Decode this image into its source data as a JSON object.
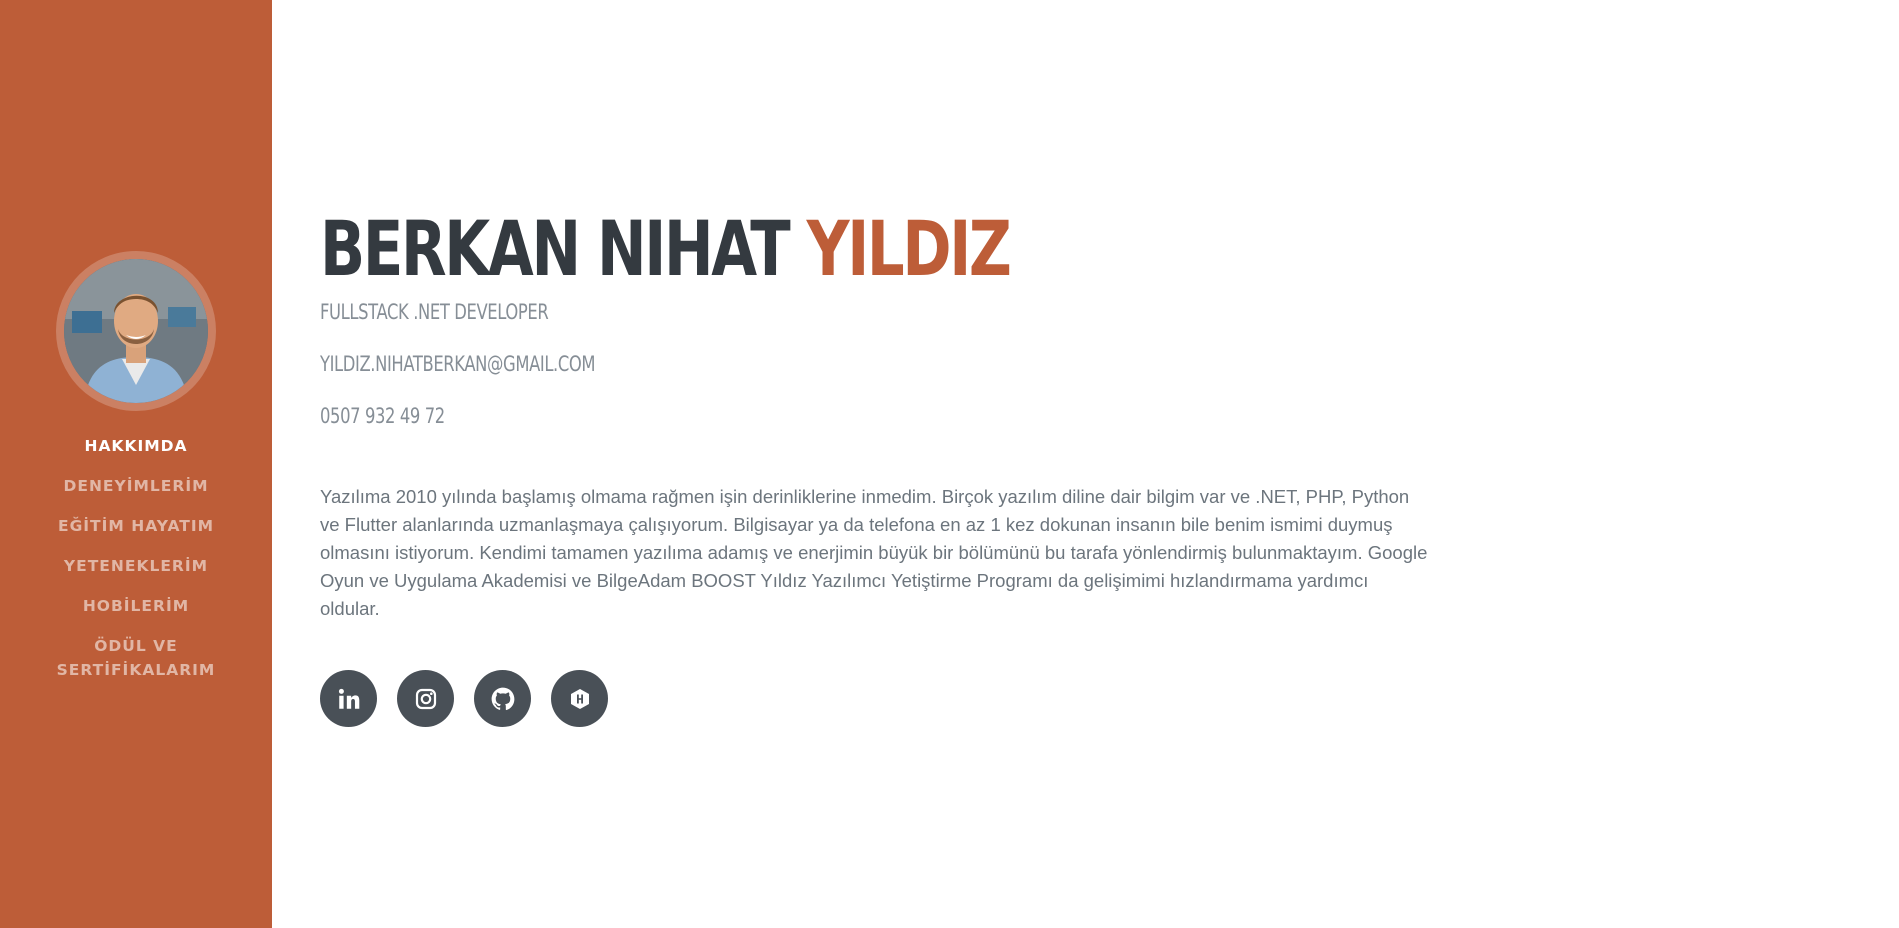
{
  "sidebar": {
    "avatar_alt": "Profile photo",
    "nav": [
      {
        "label": "HAKKIMDA",
        "active": true
      },
      {
        "label": "DENEYİMLERİM",
        "active": false
      },
      {
        "label": "EĞİTİM HAYATIM",
        "active": false
      },
      {
        "label": "YETENEKLERİM",
        "active": false
      },
      {
        "label": "HOBİLERİM",
        "active": false
      },
      {
        "label": "ÖDÜL VE SERTİFİKALARIM",
        "active": false
      }
    ],
    "background_color": "#bd5d38"
  },
  "profile": {
    "first_names": "BERKAN NIHAT",
    "last_name": "YILDIZ",
    "title": "FULLSTACK .NET DEVELOPER",
    "email": "YILDIZ.NIHATBERKAN@GMAIL.COM",
    "phone": "0507 932 49 72",
    "about": "Yazılıma 2010 yılında başlamış olmama rağmen işin derinliklerine inmedim. Birçok yazılım diline dair bilgim var ve .NET, PHP, Python ve Flutter alanlarında uzmanlaşmaya çalışıyorum. Bilgisayar ya da telefona en az 1 kez dokunan insanın bile benim ismimi duymuş olmasını istiyorum. Kendimi tamamen yazılıma adamış ve enerjimin büyük bir bölümünü bu tarafa yönlendirmiş bulunmaktayım. Google Oyun ve Uygulama Akademisi ve BilgeAdam BOOST Yıldız Yazılımcı Yetiştirme Programı da gelişimimi hızlandırmama yardımcı oldular."
  },
  "social": [
    {
      "icon": "linkedin-icon"
    },
    {
      "icon": "instagram-icon"
    },
    {
      "icon": "github-icon"
    },
    {
      "icon": "hackerrank-icon"
    }
  ],
  "colors": {
    "accent": "#bd5d38",
    "dark": "#343a40",
    "muted": "#868e96",
    "social_bg": "#495057"
  }
}
